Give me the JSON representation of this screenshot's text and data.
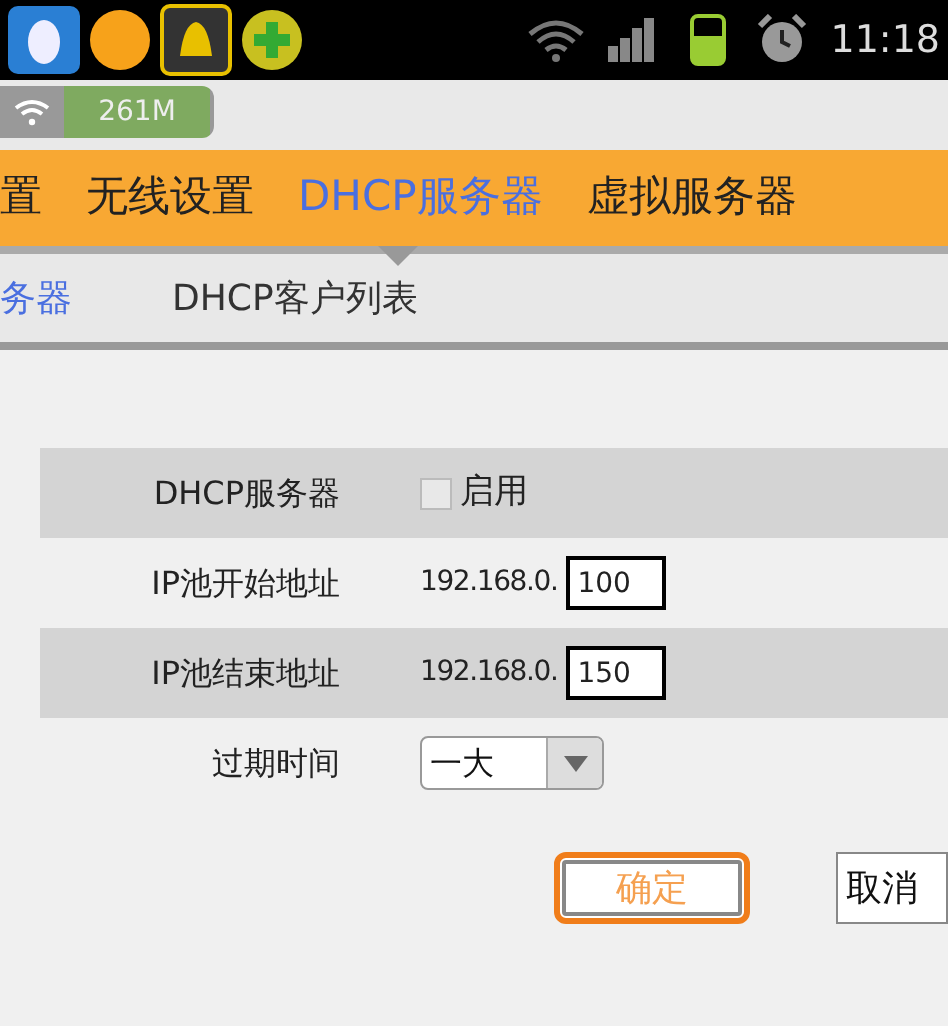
{
  "status_bar": {
    "time": "11:18"
  },
  "network_badge": {
    "speed": "261M"
  },
  "main_tabs": [
    {
      "label": "置",
      "selected": false
    },
    {
      "label": "无线设置",
      "selected": false
    },
    {
      "label": "DHCP服务器",
      "selected": true
    },
    {
      "label": "虚拟服务器",
      "selected": false
    }
  ],
  "sub_tabs": [
    {
      "label": "务器",
      "selected": true
    },
    {
      "label": "DHCP客户列表",
      "selected": false
    }
  ],
  "form": {
    "rows": [
      {
        "kind": "checkbox",
        "label": "DHCP服务器",
        "option": "启用",
        "checked": false,
        "disabled": true
      },
      {
        "kind": "ip",
        "label": "IP池开始地址",
        "prefix": "192.168.0.",
        "value": "100"
      },
      {
        "kind": "ip",
        "label": "IP池结束地址",
        "prefix": "192.168.0.",
        "value": "150"
      },
      {
        "kind": "select",
        "label": "过期时间",
        "value": "一大"
      }
    ]
  },
  "buttons": [
    {
      "label": "确定",
      "focused": true
    },
    {
      "label": "取消",
      "focused": false
    }
  ]
}
